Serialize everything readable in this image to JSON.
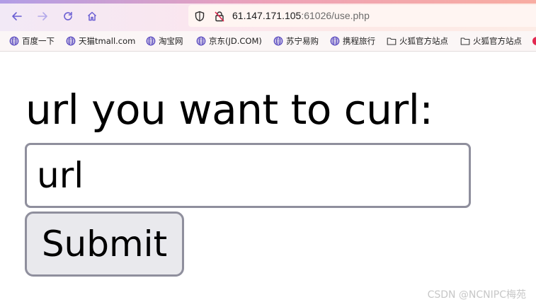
{
  "browser": {
    "url_host": "61.147.171.105",
    "url_rest": ":61026/use.php",
    "bookmarks": [
      {
        "label": "百度一下",
        "icon": "globe-icon"
      },
      {
        "label": "天猫tmall.com",
        "icon": "globe-icon"
      },
      {
        "label": "淘宝网",
        "icon": "globe-icon"
      },
      {
        "label": "京东(JD.COM)",
        "icon": "globe-icon"
      },
      {
        "label": "苏宁易购",
        "icon": "globe-icon"
      },
      {
        "label": "携程旅行",
        "icon": "globe-icon"
      },
      {
        "label": "火狐官方站点",
        "icon": "folder-icon"
      },
      {
        "label": "火狐官方站点",
        "icon": "folder-icon"
      }
    ]
  },
  "page": {
    "heading": "url you want to curl:",
    "input_placeholder": "url",
    "submit_label": "Submit"
  },
  "watermark": "CSDN @NCNIPC梅苑",
  "colors": {
    "accent_nav": "#6b5fd3",
    "input_border": "#8f8f9d",
    "button_bg": "#e9e9ed"
  }
}
